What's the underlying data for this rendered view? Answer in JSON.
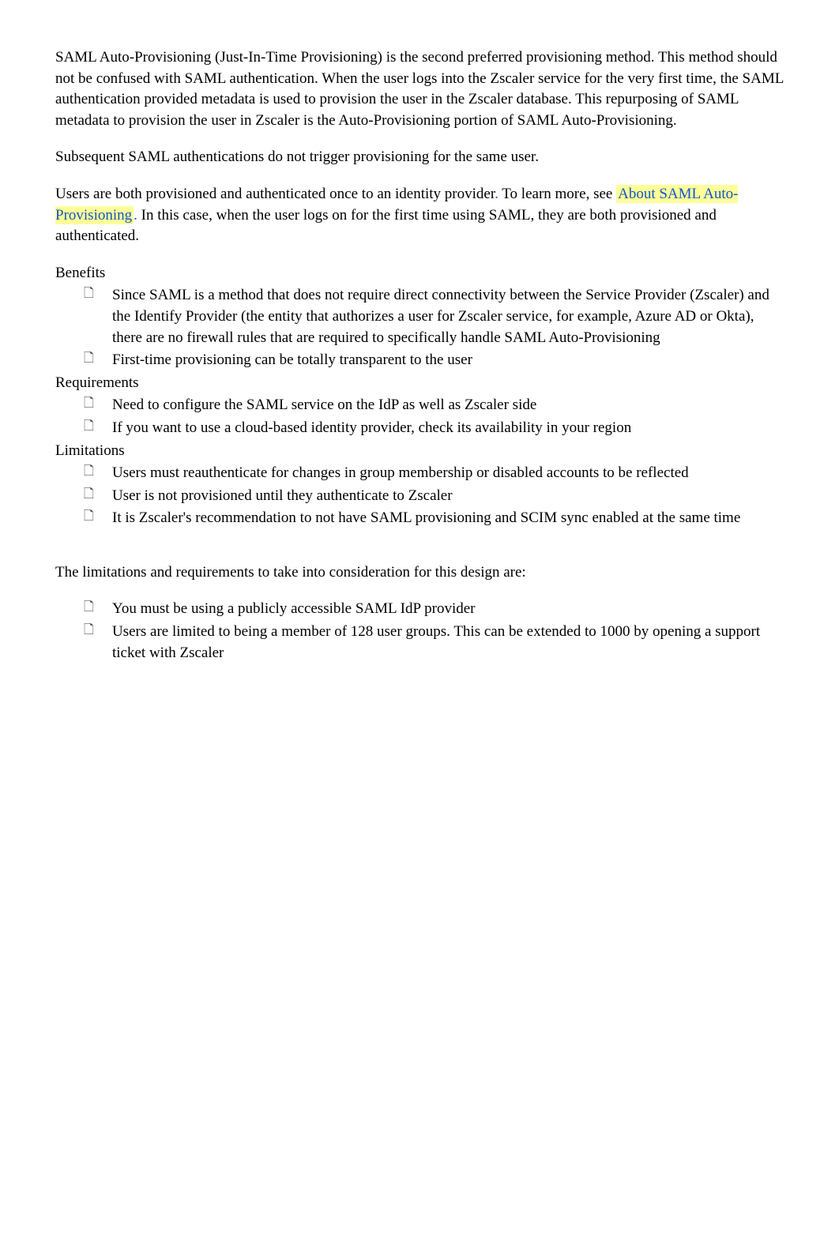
{
  "intro": {
    "p1": "SAML Auto-Provisioning (Just-In-Time Provisioning) is the second preferred provisioning method. This method should not be confused with SAML authentication. When the user logs into the Zscaler service for the very first time, the SAML authentication provided metadata is used to provision the user in the Zscaler database. This repurposing of SAML metadata to provision the user in Zscaler is the Auto-Provisioning portion of SAML Auto-Provisioning.",
    "p2": "Subsequent SAML authentications do not trigger provisioning for the same user.",
    "p3_part1": "Users are both provisioned and authenticated once to an identity provider",
    "p3_period1": ".",
    "p3_part2": " To learn more, see ",
    "p3_link": "About SAML Auto-Provisioning",
    "p3_period2": ".",
    "p3_part3": " In this case, when the user logs on for the first time using SAML, they are both provisioned and authenticated."
  },
  "benefits": {
    "header": "Benefits",
    "items": [
      "Since SAML is a method that does not require direct connectivity between the Service Provider (Zscaler) and the Identify Provider (the entity that authorizes a user for Zscaler service, for example, Azure AD or Okta), there are no firewall rules that are required to specifically handle SAML Auto-Provisioning",
      "First-time provisioning can be totally transparent to the user"
    ]
  },
  "requirements": {
    "header": "Requirements",
    "items": [
      "Need to configure the SAML service on the IdP as well as Zscaler side",
      "If you want to use a cloud-based identity provider, check its availability in your region"
    ]
  },
  "limitations": {
    "header": "Limitations",
    "items": [
      "Users must reauthenticate for changes in group membership or disabled accounts to be reflected",
      "User is not provisioned until they authenticate to Zscaler",
      "It is Zscaler's recommendation to not have SAML provisioning and SCIM sync enabled at the same time"
    ]
  },
  "design": {
    "intro": "The limitations and requirements to take into consideration for this design are:",
    "items": [
      "You must be using a publicly accessible SAML IdP provider",
      "Users are limited to being a member of 128 user groups. This can be extended to 1000 by opening a support ticket with Zscaler"
    ]
  }
}
